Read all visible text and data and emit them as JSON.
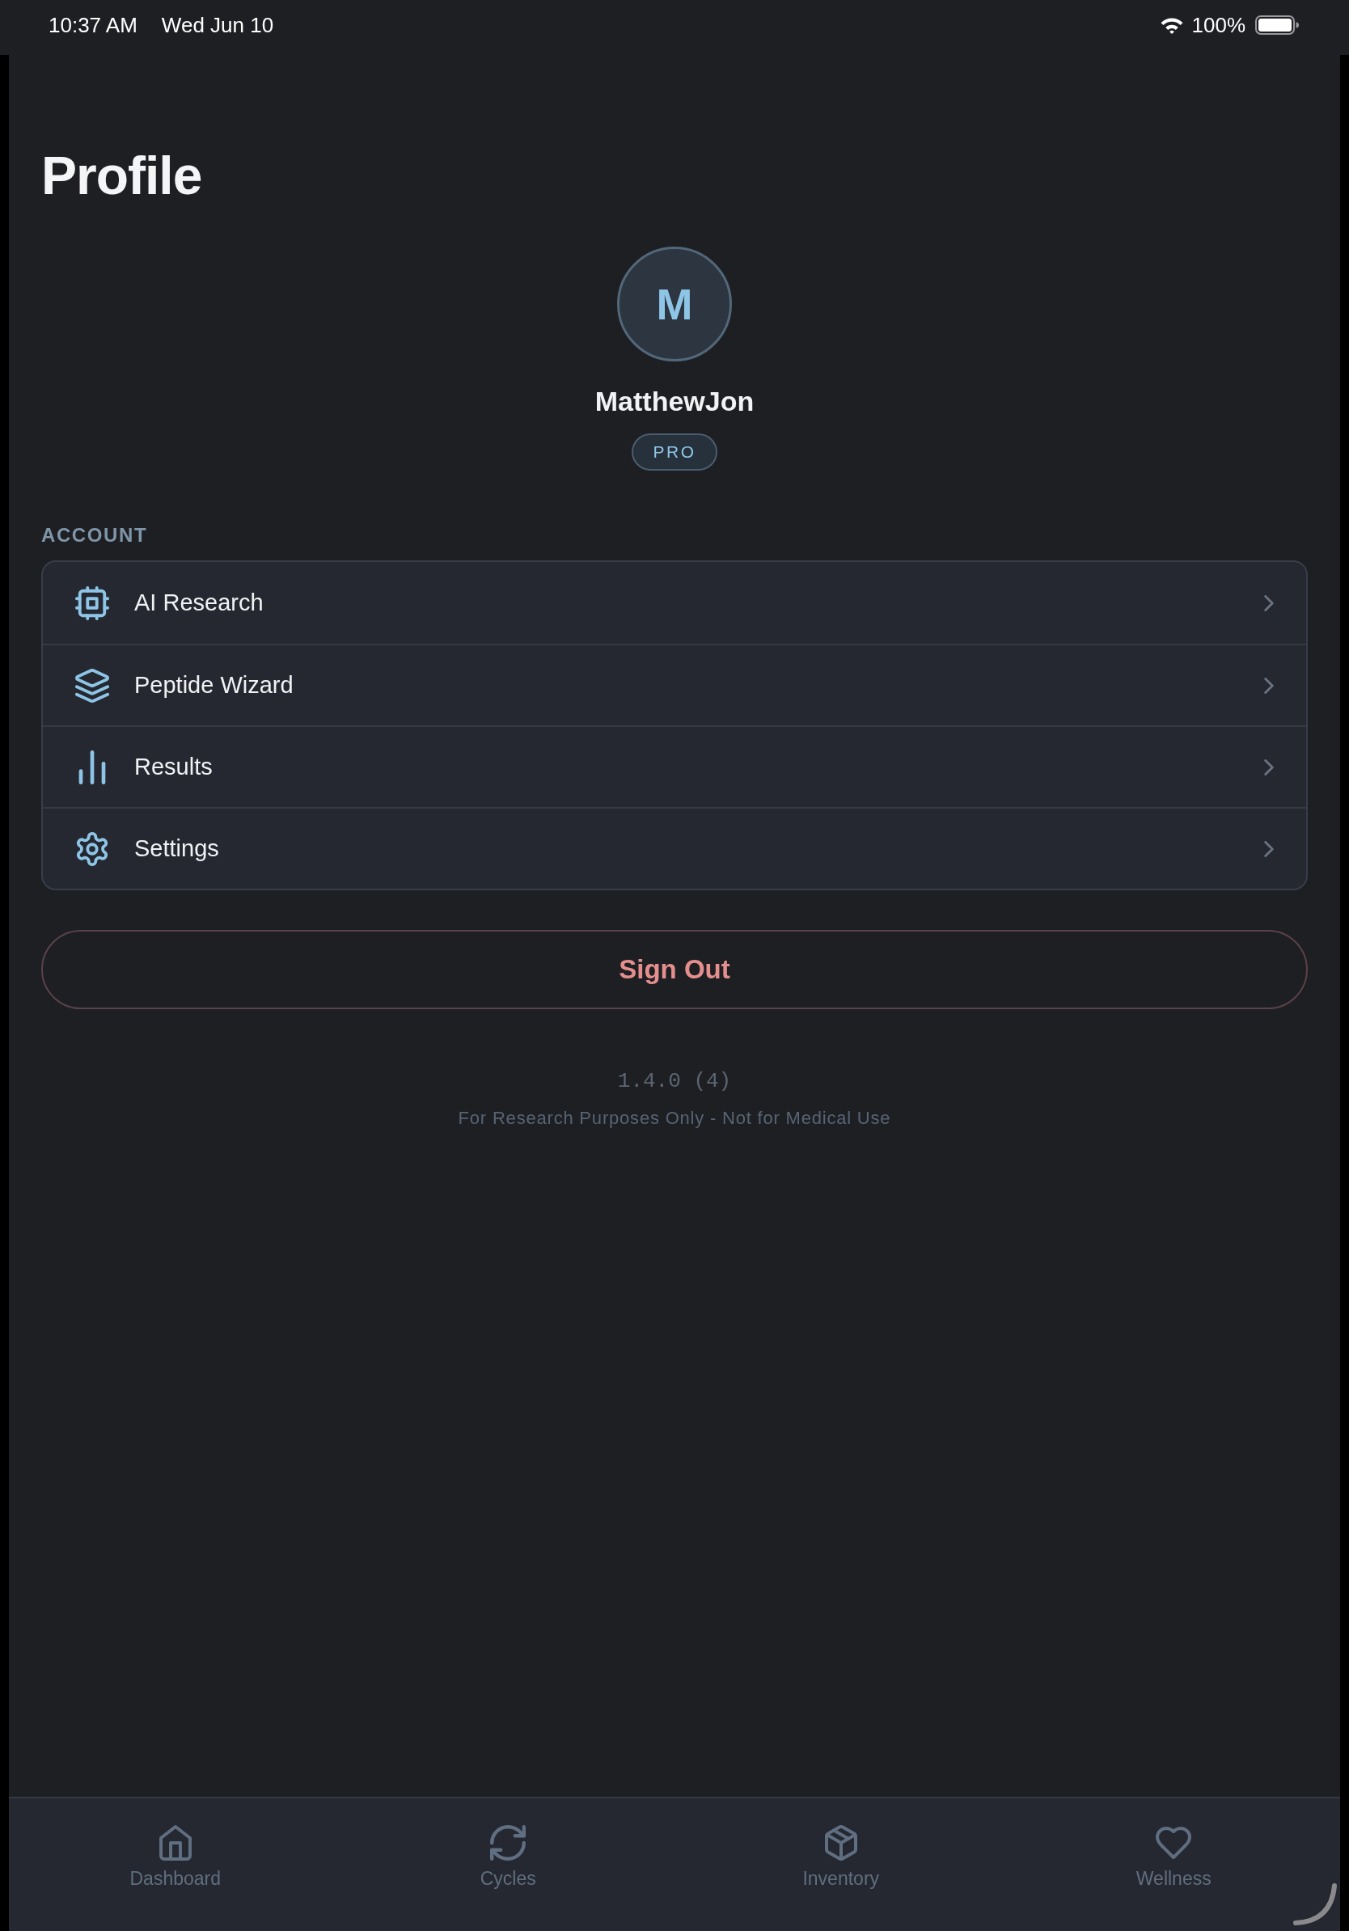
{
  "status_bar": {
    "time": "10:37 AM",
    "date": "Wed Jun 10",
    "battery": "100%"
  },
  "header": {
    "title": "Profile"
  },
  "profile": {
    "avatar_initial": "M",
    "name": "MatthewJon",
    "badge": "PRO"
  },
  "account": {
    "heading": "ACCOUNT",
    "items": [
      {
        "label": "AI Research"
      },
      {
        "label": "Peptide Wizard"
      },
      {
        "label": "Results"
      },
      {
        "label": "Settings"
      }
    ]
  },
  "sign_out": {
    "label": "Sign Out"
  },
  "footer": {
    "version": "1.4.0 (4)",
    "disclaimer": "For Research Purposes Only - Not for Medical Use"
  },
  "tab_bar": {
    "tabs": [
      {
        "label": "Dashboard",
        "selected": false
      },
      {
        "label": "Cycles",
        "selected": false
      },
      {
        "label": "Inventory",
        "selected": false
      },
      {
        "label": "Wellness",
        "selected": false
      }
    ]
  }
}
